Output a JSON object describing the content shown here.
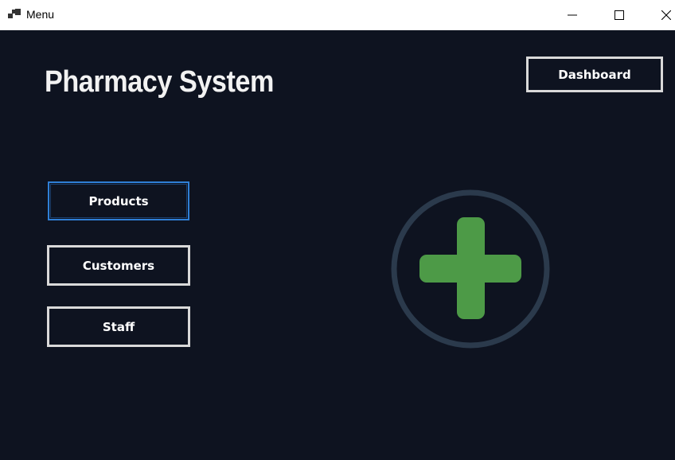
{
  "window": {
    "title": "Menu"
  },
  "header": {
    "app_title": "Pharmacy System"
  },
  "buttons": {
    "dashboard": "Dashboard",
    "products": "Products",
    "customers": "Customers",
    "staff": "Staff"
  },
  "icons": {
    "app": "app-icon",
    "minimize": "minimize-icon",
    "maximize": "maximize-icon",
    "close": "close-icon",
    "logo": "pharmacy-cross-icon"
  },
  "colors": {
    "background": "#0e1320",
    "title_bar": "#ffffff",
    "button_border": "#d9d9d9",
    "focus_border": "#2f7fd6",
    "logo_ring": "#2b3a4c",
    "logo_cross": "#4d9a47"
  }
}
